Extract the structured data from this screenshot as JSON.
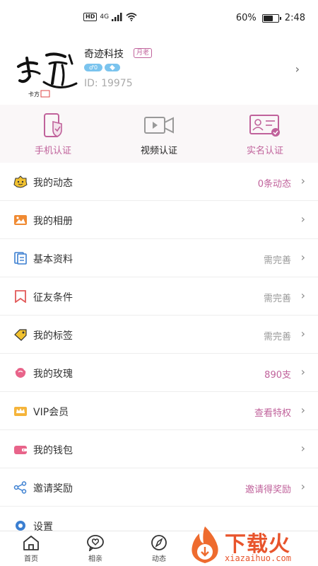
{
  "status_bar": {
    "hd": "HD",
    "network": "4G",
    "battery": "60%",
    "battery_level": 0.6,
    "time": "2:48"
  },
  "profile": {
    "name": "奇迹科技",
    "tag": "月老",
    "gender_age": "♂0",
    "id_text": "ID: 19975",
    "avatar_icon": "brand-calligraphy-logo",
    "chevron": "›"
  },
  "verifications": [
    {
      "label": "手机认证",
      "icon": "phone-verify-icon",
      "color": "#c0629b"
    },
    {
      "label": "视频认证",
      "icon": "video-verify-icon",
      "color": "#222222"
    },
    {
      "label": "实名认证",
      "icon": "id-card-verify-icon",
      "color": "#c0629b"
    }
  ],
  "menu": [
    {
      "label": "我的动态",
      "value": "0条动态",
      "value_color": "#c0629b",
      "icon": "emoji-face-icon"
    },
    {
      "label": "我的相册",
      "value": "",
      "value_color": "#999999",
      "icon": "photo-album-icon"
    },
    {
      "label": "基本资料",
      "value": "需完善",
      "value_color": "#999999",
      "icon": "profile-doc-icon"
    },
    {
      "label": "征友条件",
      "value": "需完善",
      "value_color": "#999999",
      "icon": "bookmark-icon"
    },
    {
      "label": "我的标签",
      "value": "需完善",
      "value_color": "#999999",
      "icon": "tag-icon"
    },
    {
      "label": "我的玫瑰",
      "value": "890支",
      "value_color": "#c0629b",
      "icon": "rose-icon"
    },
    {
      "label": "VIP会员",
      "value": "查看特权",
      "value_color": "#c0629b",
      "icon": "crown-icon"
    },
    {
      "label": "我的钱包",
      "value": "",
      "value_color": "#999999",
      "icon": "wallet-icon"
    },
    {
      "label": "邀请奖励",
      "value": "邀请得奖励",
      "value_color": "#c0629b",
      "icon": "share-icon"
    },
    {
      "label": "设置",
      "value": "",
      "value_color": "#999999",
      "icon": "settings-gear-icon"
    }
  ],
  "tabs": [
    {
      "label": "首页",
      "icon": "home-icon"
    },
    {
      "label": "相亲",
      "icon": "heart-chat-icon"
    },
    {
      "label": "动态",
      "icon": "compass-icon"
    }
  ],
  "watermark": {
    "title": "下载火",
    "subtitle": "xiazaihuo.com"
  },
  "colors": {
    "accent_pink": "#c0629b",
    "watermark_orange": "#e8542c"
  }
}
